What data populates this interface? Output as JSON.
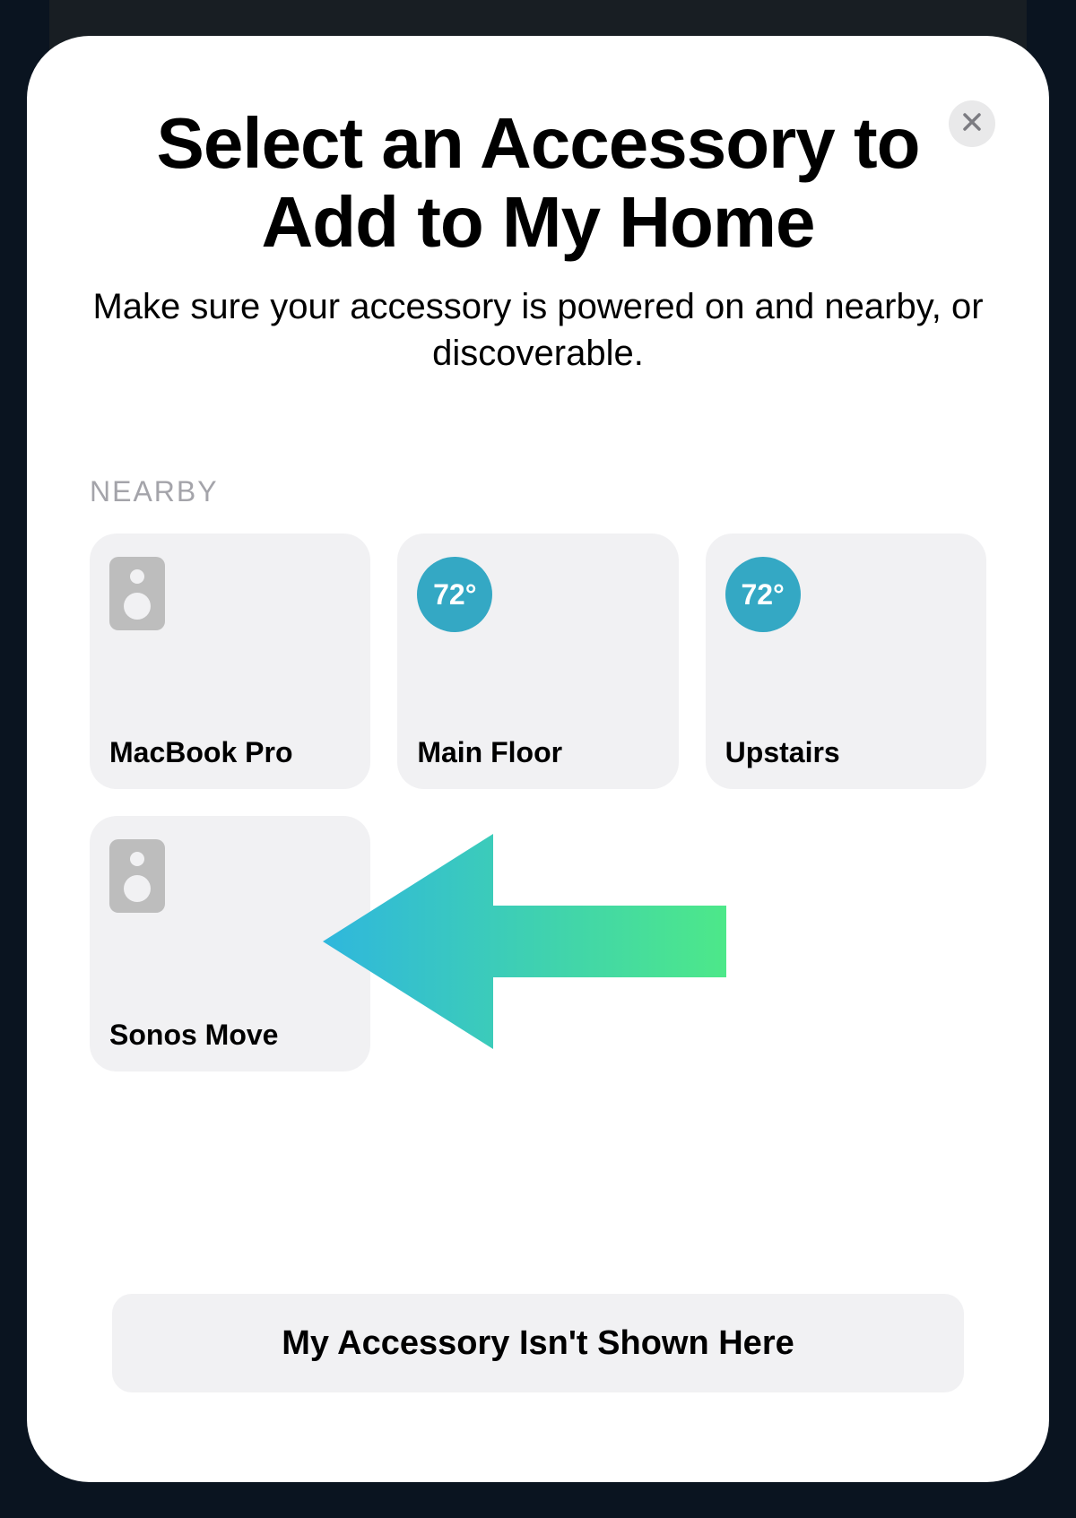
{
  "header": {
    "title": "Select an Accessory to Add to My Home",
    "subtitle": "Make sure your accessory is powered on and nearby, or discoverable."
  },
  "section_label": "NEARBY",
  "accessories": [
    {
      "label": "MacBook Pro",
      "icon": "speaker"
    },
    {
      "label": "Main Floor",
      "icon": "temp",
      "temp": "72°"
    },
    {
      "label": "Upstairs",
      "icon": "temp",
      "temp": "72°"
    },
    {
      "label": "Sonos Move",
      "icon": "speaker"
    }
  ],
  "footer_button": "My Accessory Isn't Shown Here"
}
